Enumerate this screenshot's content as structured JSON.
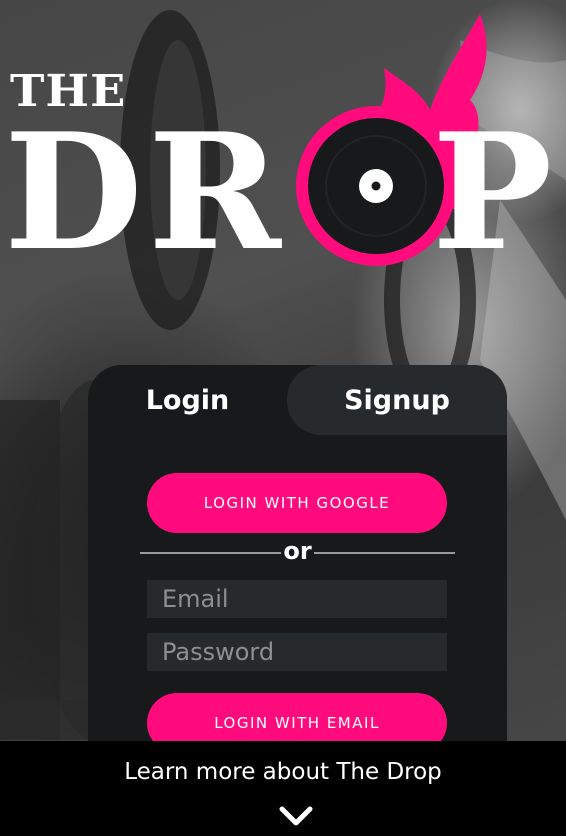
{
  "logo": {
    "the": "THE",
    "letter_d": "D",
    "letter_r": "R",
    "letter_p": "P",
    "accent_color": "#ff0b7d",
    "disc_icon": "vinyl-record-flame-icon"
  },
  "auth": {
    "tabs": [
      {
        "label": "Login",
        "active": true
      },
      {
        "label": "Signup",
        "active": false
      }
    ],
    "google_button_label": "LOGIN WITH GOOGLE",
    "divider_text": "or",
    "email_placeholder": "Email",
    "email_value": "",
    "password_placeholder": "Password",
    "password_value": "",
    "email_button_label": "LOGIN WITH EMAIL"
  },
  "footer": {
    "learn_more_label": "Learn more about The Drop",
    "chevron_icon": "chevron-down-icon"
  },
  "colors": {
    "accent": "#ff0b7d",
    "card_bg": "#18191b",
    "input_bg": "#262a2d",
    "bar_bg": "#000000"
  }
}
